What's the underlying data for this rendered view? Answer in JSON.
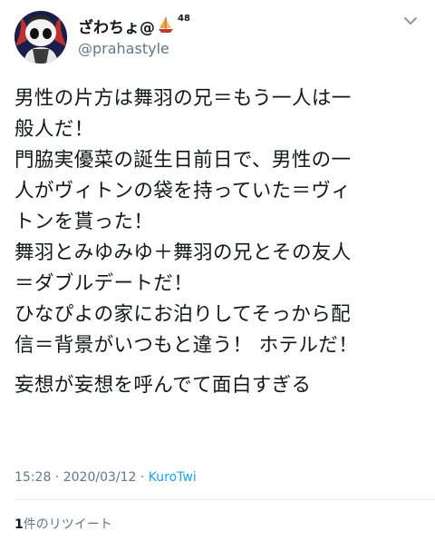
{
  "user": {
    "display_name": "ざわちょ@",
    "badge_count": "48",
    "handle": "@prahastyle"
  },
  "tweet": {
    "lines": [
      "男性の片方は舞羽の兄＝もう一人は一",
      "般人だ！",
      "門脇実優菜の誕生日前日で、男性の一",
      "人がヴィトンの袋を持っていた＝ヴィ",
      "トンを貰った！",
      "舞羽とみゆみゆ＋舞羽の兄とその友人",
      "＝ダブルデートだ！",
      "ひなぴよの家にお泊りしてそっから配",
      "信＝背景がいつもと違う！ ホテルだ！"
    ],
    "last_line": "妄想が妄想を呼んでて面白すぎる"
  },
  "meta": {
    "time": "15:28",
    "sep1": " · ",
    "date": "2020/03/12",
    "sep2": " · ",
    "app": "KuroTwi"
  },
  "retweets": {
    "count": "1",
    "label": "件のリツイート"
  },
  "icons": {
    "avatar": "avatar-image",
    "boat": "sailboat-icon",
    "chevron": "chevron-down-icon"
  },
  "colors": {
    "text": "#14171a",
    "secondary": "#657786",
    "link": "#1da1f2",
    "divider": "#e6ecf0"
  }
}
